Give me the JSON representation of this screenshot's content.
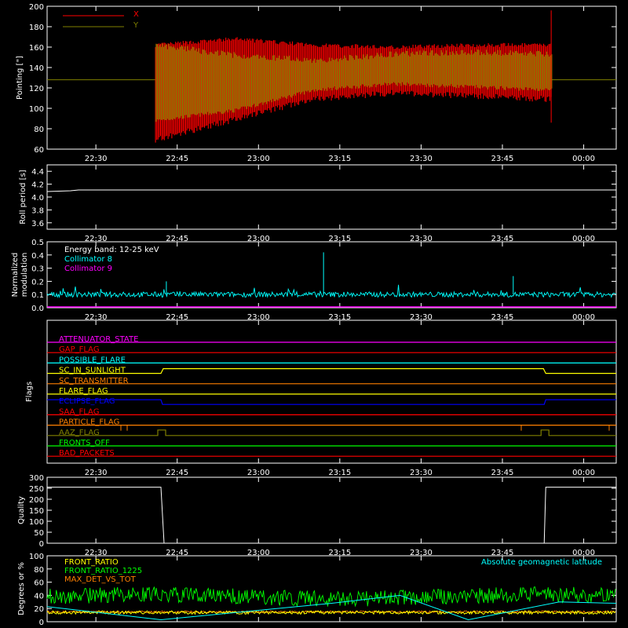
{
  "time_ticks": [
    "22:30",
    "22:45",
    "23:00",
    "23:15",
    "23:30",
    "23:45",
    "00:00"
  ],
  "colors": {
    "background": "#000000",
    "axes": "#ffffff",
    "x_series": "#ff0000",
    "y_series": "#808000",
    "collimator8": "#00ffff",
    "collimator9": "#ff00ff",
    "front_ratio": "#ffff00",
    "front_ratio_1225": "#00ff00",
    "max_det": "#ff8000",
    "geomag": "#00ffff"
  },
  "chart_data": [
    {
      "type": "line",
      "ylabel": "Pointing [\"]",
      "ylim": [
        60,
        200
      ],
      "yticks": [
        "60",
        "80",
        "100",
        "120",
        "140",
        "160",
        "180",
        "200"
      ],
      "legend": [
        "X",
        "Y"
      ],
      "legend_position": "top-left",
      "start_time": "22:41",
      "end_time": "23:54",
      "baseline": 128,
      "series": [
        {
          "name": "X",
          "upper": [
            160,
            166,
            160,
            158,
            160,
            160
          ],
          "lower": [
            72,
            92,
            112,
            118,
            115,
            112
          ]
        },
        {
          "name": "Y",
          "upper": [
            165,
            155,
            150,
            156,
            158,
            156
          ],
          "lower": [
            82,
            92,
            112,
            118,
            115,
            112
          ]
        }
      ]
    },
    {
      "type": "line",
      "ylabel": "Roll period [s]",
      "ylim": [
        3.5,
        4.5
      ],
      "yticks": [
        "3.6",
        "3.8",
        "4.0",
        "4.2",
        "4.4"
      ],
      "value": 4.11
    },
    {
      "type": "line",
      "ylabel": "Normalized modulation",
      "ylim": [
        0,
        0.5
      ],
      "yticks": [
        "0.0",
        "0.1",
        "0.2",
        "0.3",
        "0.4",
        "0.5"
      ],
      "annotation": "Energy band: 12-25 keV",
      "legend": [
        "Collimator 8",
        "Collimator 9"
      ],
      "series": [
        {
          "name": "Collimator 8",
          "mean": 0.1,
          "spikes": [
            {
              "t": "23:12",
              "v": 0.42
            },
            {
              "t": "23:47",
              "v": 0.24
            },
            {
              "t": "22:43",
              "v": 0.2
            }
          ]
        },
        {
          "name": "Collimator 9",
          "value": 0.0
        }
      ]
    },
    {
      "type": "line",
      "ylabel": "Flags",
      "flags": [
        {
          "name": "ATTENUATOR_STATE",
          "color": "#ff00ff"
        },
        {
          "name": "GAP_FLAG",
          "color": "#ff0000"
        },
        {
          "name": "POSSIBLE_FLARE",
          "color": "#00ffff"
        },
        {
          "name": "SC_IN_SUNLIGHT",
          "color": "#ffff00"
        },
        {
          "name": "SC_TRANSMITTER",
          "color": "#ff8000"
        },
        {
          "name": "FLARE_FLAG",
          "color": "#ffff00"
        },
        {
          "name": "ECLIPSE_FLAG",
          "color": "#0000ff"
        },
        {
          "name": "SAA_FLAG",
          "color": "#ff0000"
        },
        {
          "name": "PARTICLE_FLAG",
          "color": "#ff8000"
        },
        {
          "name": "AAZ_FLAG",
          "color": "#808000"
        },
        {
          "name": "FRONTS_OFF",
          "color": "#00ff00"
        },
        {
          "name": "BAD_PACKETS",
          "color": "#ff0000"
        }
      ]
    },
    {
      "type": "line",
      "ylabel": "Quality",
      "ylim": [
        0,
        300
      ],
      "yticks": [
        "0",
        "50",
        "100",
        "150",
        "200",
        "250",
        "300"
      ],
      "high": 255,
      "low": 0,
      "low_start": "22:42",
      "low_end": "23:53"
    },
    {
      "type": "line",
      "ylabel": "Degrees or %",
      "ylim": [
        0,
        100
      ],
      "yticks": [
        "0",
        "20",
        "40",
        "60",
        "80",
        "100"
      ],
      "legend": [
        "FRONT_RATIO",
        "FRONT_RATIO_1225",
        "MAX_DET_VS_TOT"
      ],
      "annotation": "Absolute geomagnetic latitude",
      "series": [
        {
          "name": "FRONT_RATIO",
          "mean": 14
        },
        {
          "name": "FRONT_RATIO_1225",
          "mean": 38
        },
        {
          "name": "MAX_DET_VS_TOT",
          "mean": 14
        },
        {
          "name": "Absolute geomagnetic latitude",
          "points": [
            [
              0,
              23
            ],
            [
              0.2,
              3
            ],
            [
              0.5,
              28
            ],
            [
              0.62,
              40
            ],
            [
              0.74,
              3
            ],
            [
              0.9,
              30
            ],
            [
              1,
              28
            ]
          ]
        }
      ]
    }
  ]
}
